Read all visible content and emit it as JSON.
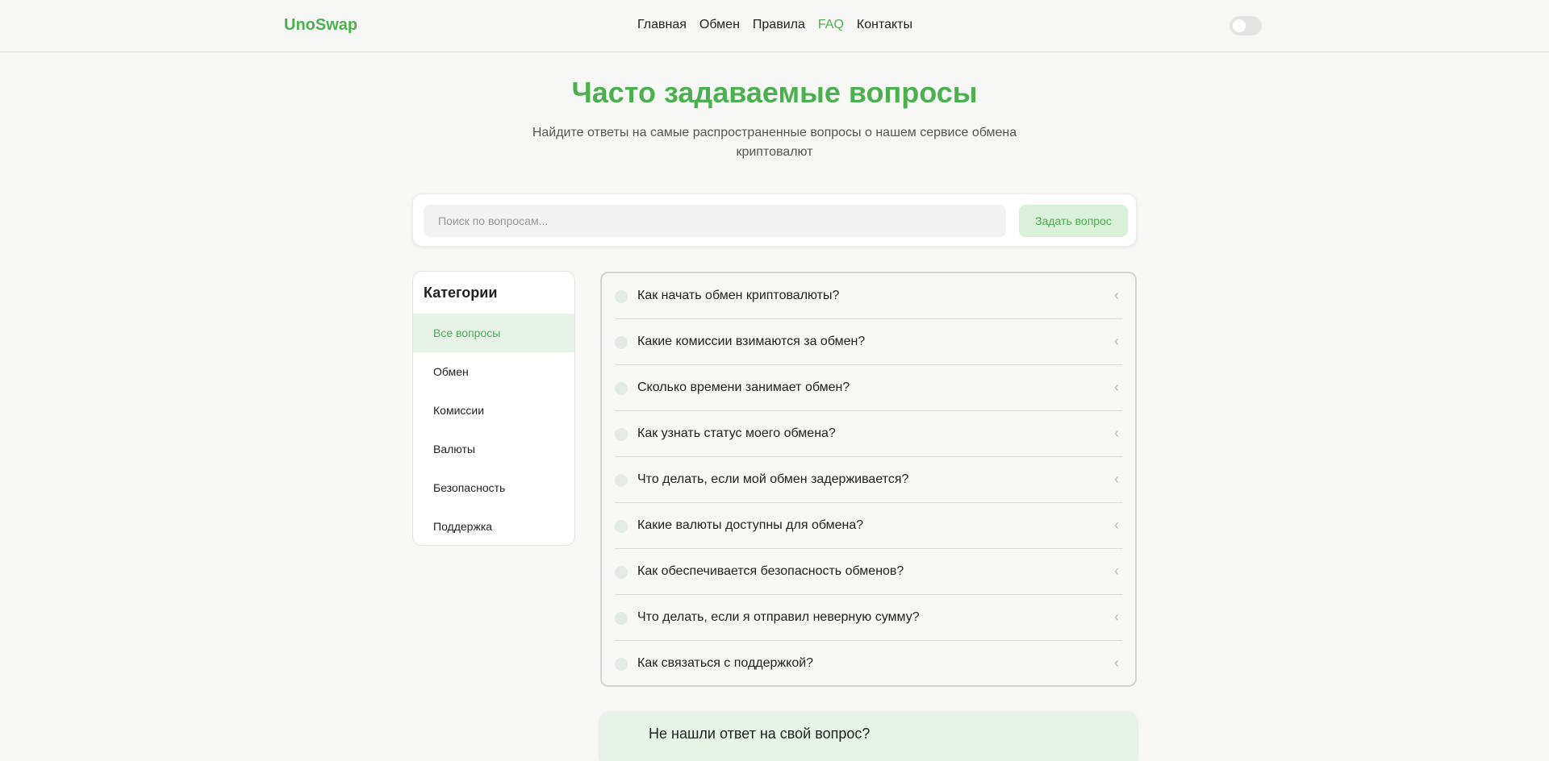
{
  "header": {
    "logo": "UnoSwap",
    "nav": [
      {
        "label": "Главная",
        "active": false
      },
      {
        "label": "Обмен",
        "active": false
      },
      {
        "label": "Правила",
        "active": false
      },
      {
        "label": "FAQ",
        "active": true
      },
      {
        "label": "Контакты",
        "active": false
      }
    ],
    "theme_toggle": {
      "on": false
    }
  },
  "hero": {
    "title": "Часто задаваемые вопросы",
    "subtitle": "Найдите ответы на самые распространенные вопросы о нашем сервисе обмена криптовалют"
  },
  "search": {
    "placeholder": "Поиск по вопросам...",
    "value": "",
    "ask_button": "Задать вопрос"
  },
  "categories": {
    "title": "Категории",
    "items": [
      {
        "label": "Все вопросы",
        "active": true
      },
      {
        "label": "Обмен",
        "active": false
      },
      {
        "label": "Комиссии",
        "active": false
      },
      {
        "label": "Валюты",
        "active": false
      },
      {
        "label": "Безопасность",
        "active": false
      },
      {
        "label": "Поддержка",
        "active": false
      }
    ]
  },
  "faq": {
    "items": [
      {
        "question": "Как начать обмен криптовалюты?",
        "expanded": false
      },
      {
        "question": "Какие комиссии взимаются за обмен?",
        "expanded": false
      },
      {
        "question": "Сколько времени занимает обмен?",
        "expanded": false
      },
      {
        "question": "Как узнать статус моего обмена?",
        "expanded": false
      },
      {
        "question": "Что делать, если мой обмен задерживается?",
        "expanded": false
      },
      {
        "question": "Какие валюты доступны для обмена?",
        "expanded": false
      },
      {
        "question": "Как обеспечивается безопасность обменов?",
        "expanded": false
      },
      {
        "question": "Что делать, если я отправил неверную сумму?",
        "expanded": false
      },
      {
        "question": "Как связаться с поддержкой?",
        "expanded": false
      }
    ],
    "chevron_icon": "chevron-left-icon",
    "bullet_icon": "circle-icon"
  },
  "help": {
    "title": "Не нашли ответ на свой вопрос?"
  },
  "colors": {
    "accent": "#4caf50",
    "accent_light": "#d9f0d9",
    "background": "#f7f7f6"
  }
}
